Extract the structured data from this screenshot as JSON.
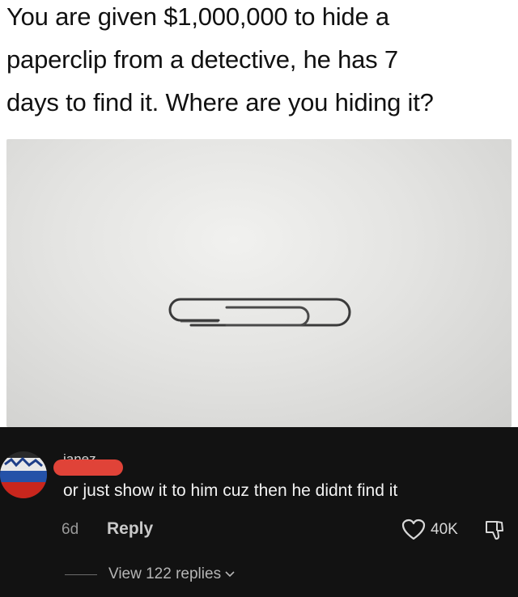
{
  "post": {
    "text_line1": "You are given $1,000,000 to hide a",
    "text_line2": "paperclip from a detective, he has 7",
    "text_line3": "days to find it. Where are you hiding it?"
  },
  "image": {
    "subject": "paperclip-on-white-background"
  },
  "comment": {
    "username": "janez",
    "text": "or just show it to him cuz then he didnt find it",
    "time": "6d",
    "reply_label": "Reply",
    "likes": "40K",
    "view_replies_label": "View 122 replies"
  },
  "colors": {
    "background_top": "#ffffff",
    "comment_background": "#121212",
    "redaction": "#e04338"
  }
}
